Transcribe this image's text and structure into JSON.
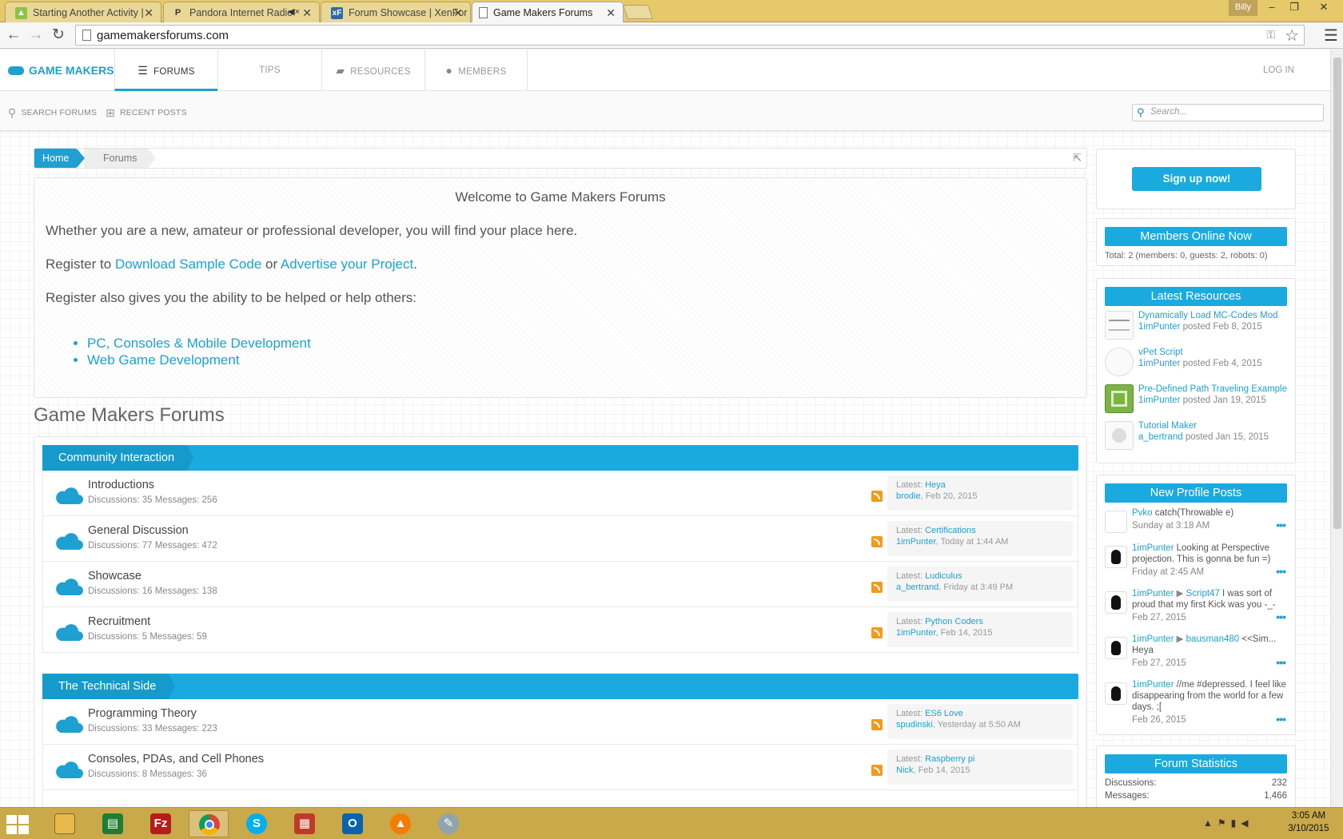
{
  "browser": {
    "tabs": [
      {
        "title": "Starting Another Activity |",
        "favicon": "android-icon",
        "color": "#8bc34a"
      },
      {
        "title": "Pandora Internet Radio",
        "favicon": "pandora-icon",
        "color": "#ffffff",
        "muted": true
      },
      {
        "title": "Forum Showcase | XenFor",
        "favicon": "xenforo-icon",
        "color": "#2e6aa6"
      },
      {
        "title": "Game Makers Forums",
        "favicon": "page-icon",
        "color": "#ffffff",
        "active": true
      }
    ],
    "user": "Billy",
    "url": "gamemakersforums.com"
  },
  "site": {
    "logo": "GAME MAKERS",
    "nav": [
      {
        "label": "FORUMS",
        "icon": "list-icon",
        "active": true
      },
      {
        "label": "TIPS",
        "icon": "",
        "active": false
      },
      {
        "label": "RESOURCES",
        "icon": "folder-icon",
        "active": false
      },
      {
        "label": "MEMBERS",
        "icon": "user-icon",
        "active": false
      }
    ],
    "login": "LOG IN",
    "subnav": [
      {
        "label": "SEARCH FORUMS",
        "icon": "search-icon"
      },
      {
        "label": "RECENT POSTS",
        "icon": "plus-box-icon"
      }
    ],
    "search_placeholder": "Search..."
  },
  "breadcrumb": {
    "home": "Home",
    "current": "Forums"
  },
  "notice": {
    "title": "Welcome to Game Makers Forums",
    "line1": "Whether you are a new, amateur or professional developer, you will find your place here.",
    "line2_prefix": "Register to ",
    "link_download": "Download Sample Code",
    "line2_or": " or ",
    "link_advertise": "Advertise your Project",
    "line2_suffix": ".",
    "line3": "Register also gives you the ability to be helped or help others:",
    "links": [
      "PC, Consoles & Mobile Development",
      "Web Game Development"
    ]
  },
  "forums": {
    "title": "Game Makers Forums",
    "categories": [
      {
        "name": "Community Interaction",
        "forums": [
          {
            "name": "Introductions",
            "stats": "Discussions: 35 Messages: 256",
            "latest_title": "Heya",
            "latest_user": "brodie",
            "latest_date": ", Feb 20, 2015"
          },
          {
            "name": "General Discussion",
            "stats": "Discussions: 77 Messages: 472",
            "latest_title": "Certifications",
            "latest_user": "1imPunter",
            "latest_date": ", Today at 1:44 AM"
          },
          {
            "name": "Showcase",
            "stats": "Discussions: 16 Messages: 138",
            "latest_title": "Ludiculus",
            "latest_user": "a_bertrand",
            "latest_date": ", Friday at 3:49 PM"
          },
          {
            "name": "Recruitment",
            "stats": "Discussions: 5 Messages: 59",
            "latest_title": "Python Coders",
            "latest_user": "1imPunter",
            "latest_date": ", Feb 14, 2015"
          }
        ]
      },
      {
        "name": "The Technical Side",
        "forums": [
          {
            "name": "Programming Theory",
            "stats": "Discussions: 33 Messages: 223",
            "latest_title": "ES6 Love",
            "latest_user": "spudinski",
            "latest_date": ", Yesterday at 5:50 AM"
          },
          {
            "name": "Consoles, PDAs, and Cell Phones",
            "stats": "Discussions: 8 Messages: 36",
            "latest_title": "Raspberry pi",
            "latest_user": "Nick",
            "latest_date": ", Feb 14, 2015"
          }
        ]
      }
    ],
    "latest_prefix": "Latest: "
  },
  "sidebar": {
    "signup": "Sign up now!",
    "members_online": {
      "title": "Members Online Now",
      "total": "Total: 2 (members: 0, guests: 2, robots: 0)"
    },
    "latest_resources": {
      "title": "Latest Resources",
      "items": [
        {
          "title": "Dynamically Load MC-Codes Mod",
          "user": "1imPunter",
          "posted": " posted Feb 8, 2015"
        },
        {
          "title": "vPet Script",
          "user": "1imPunter",
          "posted": " posted Feb 4, 2015"
        },
        {
          "title": "Pre-Defined Path Traveling Example",
          "user": "1imPunter",
          "posted": " posted Jan 19, 2015"
        },
        {
          "title": "Tutorial Maker",
          "user": "a_bertrand",
          "posted": " posted Jan 15, 2015"
        }
      ]
    },
    "profile_posts": {
      "title": "New Profile Posts",
      "items": [
        {
          "user": "Pvko",
          "target": "",
          "text": " catch(Throwable e)",
          "time": "Sunday at 3:18 AM"
        },
        {
          "user": "1imPunter",
          "target": "",
          "text": " Looking at Perspective projection. This is gonna be fun =)",
          "time": "Friday at 2:45 AM"
        },
        {
          "user": "1imPunter",
          "target": "Script47",
          "text": " I was sort of proud that my first Kick was you -_-",
          "time": "Feb 27, 2015"
        },
        {
          "user": "1imPunter",
          "target": "bausman480",
          "text": " <<Sim... Heya",
          "time": "Feb 27, 2015"
        },
        {
          "user": "1imPunter",
          "target": "",
          "text": " //me #depressed. I feel like disappearing from the world for a few days. ;[",
          "time": "Feb 26, 2015"
        }
      ],
      "arrow": " ▶ ",
      "more": "•••"
    },
    "forum_stats": {
      "title": "Forum Statistics",
      "rows": [
        {
          "label": "Discussions:",
          "value": "232"
        },
        {
          "label": "Messages:",
          "value": "1,466"
        }
      ]
    }
  },
  "taskbar": {
    "clock_time": "3:05 AM",
    "clock_date": "3/10/2015",
    "apps": [
      "windows-start-icon",
      "file-explorer-icon",
      "spreadsheet-icon",
      "filezilla-icon",
      "chrome-icon",
      "skype-icon",
      "photo-app-icon",
      "outlook-icon",
      "vlc-icon",
      "paint-icon"
    ]
  }
}
